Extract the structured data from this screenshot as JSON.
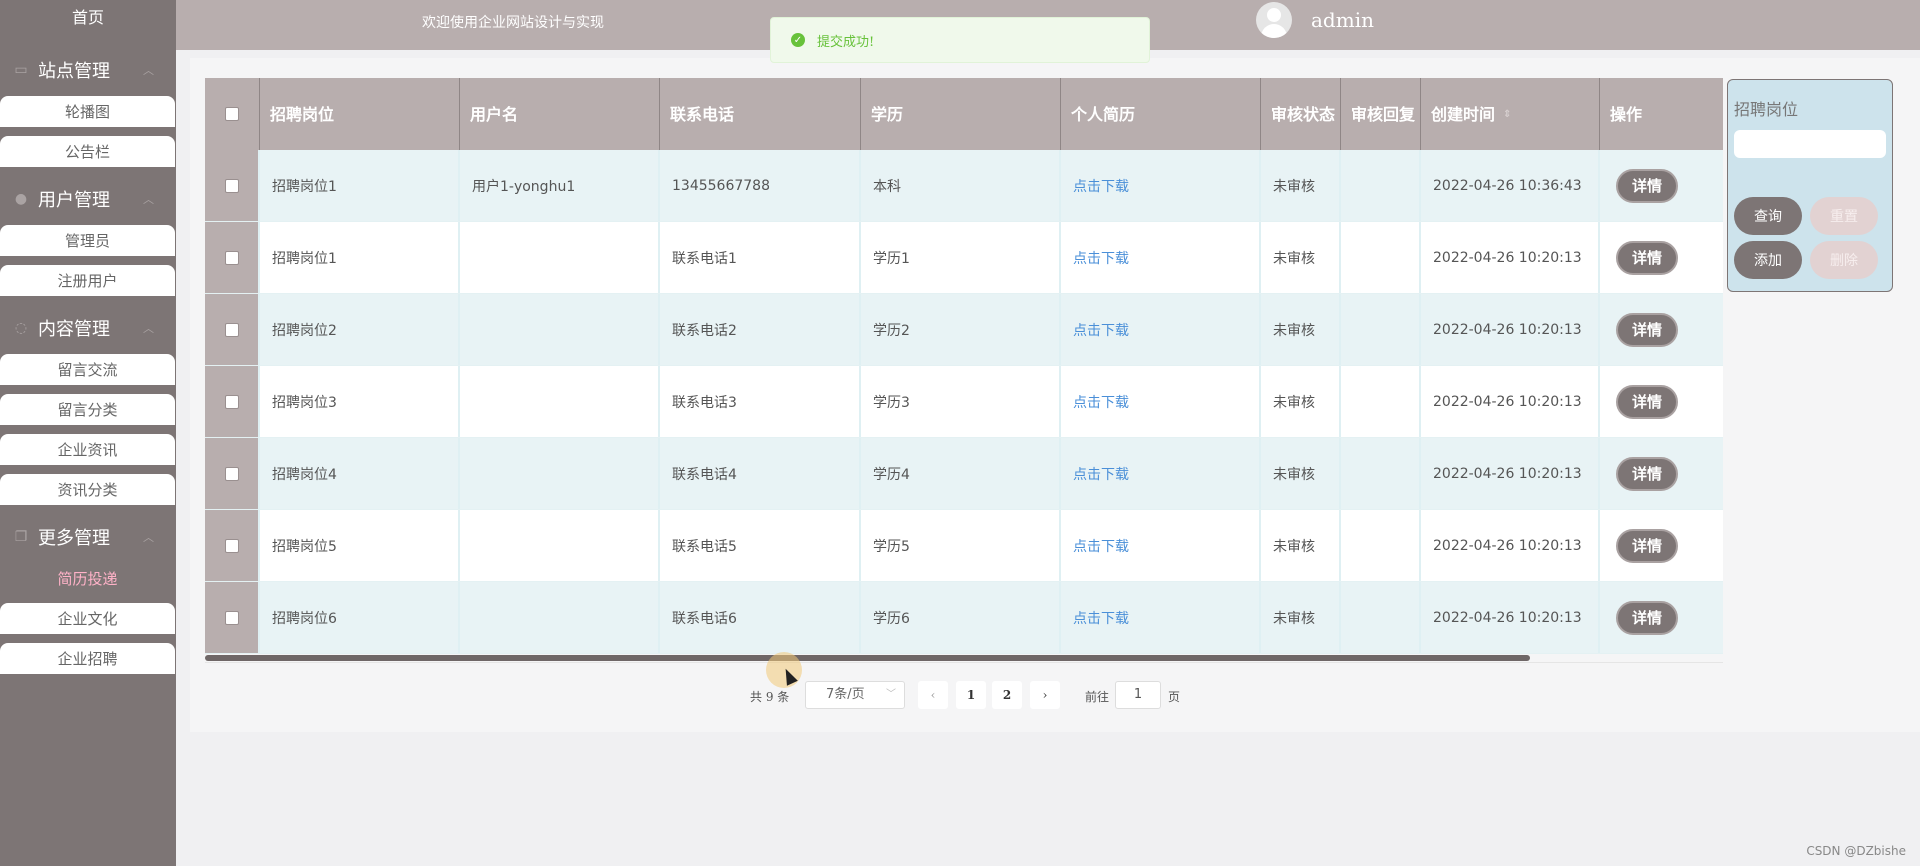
{
  "sidebar": {
    "home": "首页",
    "groups": [
      {
        "title": "站点管理",
        "items": [
          "轮播图",
          "公告栏"
        ]
      },
      {
        "title": "用户管理",
        "items": [
          "管理员",
          "注册用户"
        ]
      },
      {
        "title": "内容管理",
        "items": [
          "留言交流",
          "留言分类",
          "企业资讯",
          "资讯分类"
        ]
      },
      {
        "title": "更多管理",
        "items": [
          "简历投递",
          "企业文化",
          "企业招聘"
        ]
      }
    ]
  },
  "header": {
    "welcome": "欢迎使用企业网站设计与实现",
    "username": "admin"
  },
  "toast": {
    "message": "提交成功!"
  },
  "table": {
    "headers": [
      "招聘岗位",
      "用户名",
      "联系电话",
      "学历",
      "个人简历",
      "审核状态",
      "审核回复",
      "创建时间",
      "操作"
    ],
    "rows": [
      [
        "招聘岗位1",
        "用户1-yonghu1",
        "13455667788",
        "本科",
        "点击下载",
        "未审核",
        "",
        "2022-04-26 10:36:43",
        "详情"
      ],
      [
        "招聘岗位1",
        "",
        "联系电话1",
        "学历1",
        "点击下载",
        "未审核",
        "",
        "2022-04-26 10:20:13",
        "详情"
      ],
      [
        "招聘岗位2",
        "",
        "联系电话2",
        "学历2",
        "点击下载",
        "未审核",
        "",
        "2022-04-26 10:20:13",
        "详情"
      ],
      [
        "招聘岗位3",
        "",
        "联系电话3",
        "学历3",
        "点击下载",
        "未审核",
        "",
        "2022-04-26 10:20:13",
        "详情"
      ],
      [
        "招聘岗位4",
        "",
        "联系电话4",
        "学历4",
        "点击下载",
        "未审核",
        "",
        "2022-04-26 10:20:13",
        "详情"
      ],
      [
        "招聘岗位5",
        "",
        "联系电话5",
        "学历5",
        "点击下载",
        "未审核",
        "",
        "2022-04-26 10:20:13",
        "详情"
      ],
      [
        "招聘岗位6",
        "",
        "联系电话6",
        "学历6",
        "点击下载",
        "未审核",
        "",
        "2022-04-26 10:20:13",
        "详情"
      ]
    ]
  },
  "search": {
    "label": "招聘岗位",
    "input_value": "",
    "query": "查询",
    "reset": "重置",
    "add": "添加",
    "delete": "删除"
  },
  "pager": {
    "total": "共 9 条",
    "page_size": "7条/页",
    "pages": [
      "1",
      "2"
    ],
    "goto_prefix": "前往",
    "goto_value": "1",
    "goto_suffix": "页"
  },
  "watermark": "CSDN @DZbishe",
  "colors": {
    "sidebar": "#7d7575",
    "header": "#b8aeae",
    "active_item": "#ffb2c8",
    "link": "#4a8fd8",
    "success": "#67c23a"
  }
}
